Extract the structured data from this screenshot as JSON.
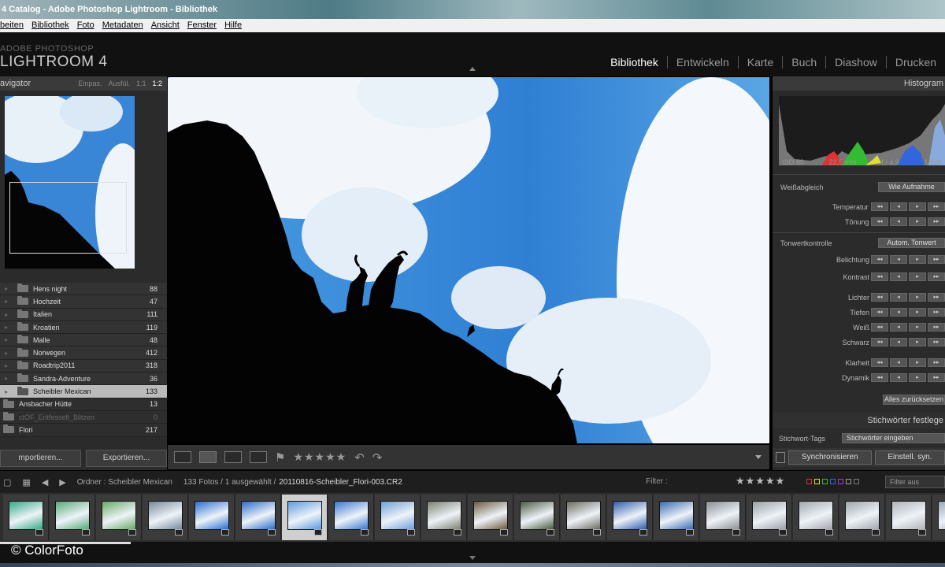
{
  "window": {
    "title": "4 Catalog - Adobe Photoshop Lightroom - Bibliothek"
  },
  "menu": [
    "beiten",
    "Bibliothek",
    "Foto",
    "Metadaten",
    "Ansicht",
    "Fenster",
    "Hilfe"
  ],
  "brand": {
    "small": "ADOBE PHOTOSHOP",
    "big": "LIGHTROOM 4"
  },
  "modules": [
    "Bibliothek",
    "Entwickeln",
    "Karte",
    "Buch",
    "Diashow",
    "Drucken"
  ],
  "active_module": "Bibliothek",
  "navigator": {
    "title": "avigator",
    "zoom_options": [
      "Einpas.",
      "Ausfül.",
      "1:1",
      "1:2"
    ],
    "selected_zoom": "1:2"
  },
  "folders": [
    {
      "name": "Hens night",
      "count": "88",
      "level": "sub"
    },
    {
      "name": "Hochzeit",
      "count": "47",
      "level": "sub"
    },
    {
      "name": "Italien",
      "count": "111",
      "level": "sub"
    },
    {
      "name": "Kroatien",
      "count": "119",
      "level": "sub"
    },
    {
      "name": "Malle",
      "count": "48",
      "level": "sub"
    },
    {
      "name": "Norwegen",
      "count": "412",
      "level": "sub"
    },
    {
      "name": "Roadtrip2011",
      "count": "318",
      "level": "sub"
    },
    {
      "name": "Sandra-Adventure",
      "count": "36",
      "level": "sub"
    },
    {
      "name": "Scheibler Mexican",
      "count": "133",
      "level": "sub",
      "selected": true
    },
    {
      "name": "Ansbacher Hütte",
      "count": "13",
      "level": "top"
    },
    {
      "name": "ctOF_Entfesselt_Blitzen",
      "count": "0",
      "level": "top",
      "dim": true
    },
    {
      "name": "Flori",
      "count": "217",
      "level": "top"
    }
  ],
  "left_buttons": {
    "import": "mportieren...",
    "export": "Exportieren..."
  },
  "toolbar": {
    "stars": "★★★★★"
  },
  "histogram": {
    "title": "Histogram",
    "iso": "ISO 80",
    "focal": "22,5 mm",
    "aperture": "f / 4,9",
    "shutter": "1/500"
  },
  "quick_develop": {
    "wb_label": "Weißabgleich",
    "wb_value": "Wie Aufnahme",
    "temperature": "Temperatur",
    "tint": "Tönung",
    "tone_label": "Tonwertkontrolle",
    "auto_tone": "Autom. Tonwert",
    "exposure": "Belichtung",
    "contrast": "Kontrast",
    "highlights": "Lichter",
    "shadows": "Tiefen",
    "whites": "Weiß",
    "blacks": "Schwarz",
    "clarity": "Klarheit",
    "vibrance": "Dynamik",
    "reset_all": "Alles zurücksetzen",
    "mini_labels": [
      "◂◂",
      "◂",
      "▸",
      "▸▸"
    ]
  },
  "keywords": {
    "title": "Stichwörter festlege",
    "tags_label": "Stichwort-Tags",
    "tags_placeholder": "Stichwörter eingeben"
  },
  "sync": {
    "sync_button": "Synchronisieren",
    "settings_button": "Einstell. syn."
  },
  "filmstrip_header": {
    "folder": "Ordner : Scheibler Mexican",
    "count": "133 Fotos / 1 ausgewählt /",
    "file": "20110816-Scheibler_Flori-003.CR2",
    "filter": "Filter :",
    "filter_stars": "★★★★★",
    "filter_off": "Filter aus"
  },
  "filter_colors": [
    "#d33",
    "#dd3",
    "#3b3",
    "#36d",
    "#a3d",
    "#999",
    "#777"
  ],
  "thumbnails": [
    {
      "bg": "#3a8"
    },
    {
      "bg": "#5a7"
    },
    {
      "bg": "#6a6"
    },
    {
      "bg": "#789"
    },
    {
      "bg": "#2a6fd0"
    },
    {
      "bg": "#2b6dc8"
    },
    {
      "bg": "#5c9be0",
      "selected": true
    },
    {
      "bg": "#3a78d0"
    },
    {
      "bg": "#6f9fd8"
    },
    {
      "bg": "#7a8070"
    },
    {
      "bg": "#6b5a40"
    },
    {
      "bg": "#4a5a40"
    },
    {
      "bg": "#6a6a60"
    },
    {
      "bg": "#2d5dac"
    },
    {
      "bg": "#3a6ab0"
    },
    {
      "bg": "#8a8e92"
    },
    {
      "bg": "#9aa0a6"
    },
    {
      "bg": "#a4a8ae"
    },
    {
      "bg": "#a0a6ac"
    },
    {
      "bg": "#b0b4b8"
    },
    {
      "bg": "#9aa8b4"
    }
  ],
  "watermark": "© ColorFoto"
}
